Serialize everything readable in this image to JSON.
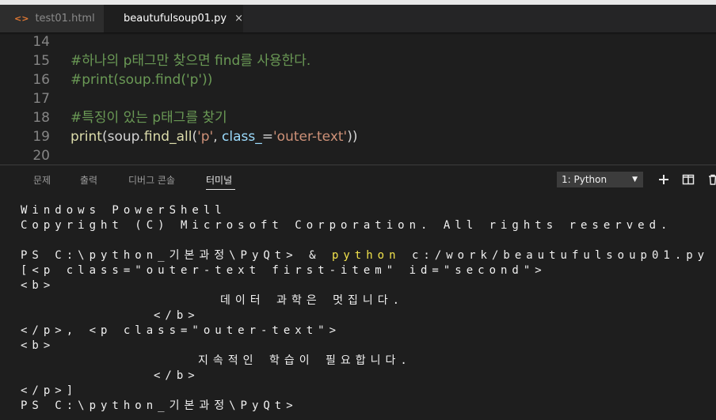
{
  "tabs": [
    {
      "label": "test01.html",
      "icon": "html-file-icon",
      "active": false
    },
    {
      "label": "beautufulsoup01.py",
      "icon": "python-file-icon",
      "active": true,
      "close": "×"
    }
  ],
  "editor": {
    "lines": [
      {
        "num": "14",
        "text": ""
      },
      {
        "num": "15",
        "text": "#하나의 p태그만 찾으면 find를 사용한다."
      },
      {
        "num": "16",
        "text": "#print(soup.find('p'))"
      },
      {
        "num": "17",
        "text": ""
      },
      {
        "num": "18",
        "text": "#특징이 있는 p태그를 찾기"
      },
      {
        "num": "19",
        "text": "print(soup.find_all('p', class_='outer-text'))"
      },
      {
        "num": "20",
        "text": ""
      }
    ],
    "line19_parts": {
      "fn": "print",
      "a": "(soup.",
      "method": "find_all",
      "b": "(",
      "s1": "'p'",
      "c": ", ",
      "param": "class_",
      "d": "=",
      "s2": "'outer-text'",
      "e": "))"
    }
  },
  "panel": {
    "tabs": [
      "문제",
      "출력",
      "디버그 콘솔",
      "터미널"
    ],
    "active_tab": "터미널",
    "terminal_select": "1: Python",
    "buttons": [
      "add-icon",
      "split-icon",
      "trash-icon"
    ]
  },
  "terminal": {
    "l1": "Windows PowerShell",
    "l2": "Copyright (C) Microsoft Corporation. All rights reserved.",
    "l3_prompt": "PS C:\\python_기본과정\\PyQt> & ",
    "l3_cmd": "python",
    "l3_rest": " c:/work/beautufulsoup01.py",
    "l4": "[<p class=\"outer-text first-item\" id=\"second\">",
    "l5": "<b>",
    "l6": "데이터 과학은 멋집니다.",
    "l7": "</b>",
    "l8": "</p>, <p class=\"outer-text\">",
    "l9": "<b>",
    "l10": "지속적인 학습이 필요합니다.",
    "l11": "</b>",
    "l12": "</p>]",
    "l13": "PS C:\\python_기본과정\\PyQt>"
  },
  "colors": {
    "comment": "#6a9955",
    "function": "#dcdcaa",
    "string": "#ce9178",
    "parameter": "#9cdcfe",
    "python_cmd": "#f2e34c"
  }
}
